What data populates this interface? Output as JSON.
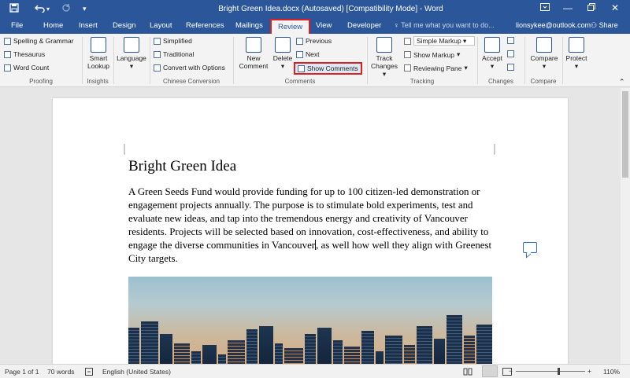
{
  "titlebar": {
    "title": "Bright Green Idea.docx (Autosaved) [Compatibility Mode] - Word",
    "save_icon": "save-icon",
    "undo_icon": "undo-icon",
    "redo_icon": "redo-icon"
  },
  "tabs": [
    "File",
    "Home",
    "Insert",
    "Design",
    "Layout",
    "References",
    "Mailings",
    "Review",
    "View",
    "Developer"
  ],
  "active_tab": "Review",
  "tell_me": "Tell me what you want to do...",
  "account": {
    "user": "lionsykee@outlook.com",
    "share": "Share"
  },
  "ribbon": {
    "proofing": {
      "spelling": "Spelling & Grammar",
      "thesaurus": "Thesaurus",
      "word_count": "Word Count",
      "label": "Proofing"
    },
    "insights": {
      "smart_lookup": "Smart Lookup",
      "label": "Insights"
    },
    "language": {
      "language": "Language"
    },
    "chinese": {
      "simplified": "Simplified",
      "traditional": "Traditional",
      "convert": "Convert with Options",
      "label": "Chinese Conversion"
    },
    "comments": {
      "new_comment": "New Comment",
      "delete": "Delete",
      "previous": "Previous",
      "next": "Next",
      "show_comments": "Show Comments",
      "label": "Comments"
    },
    "tracking": {
      "track_changes": "Track Changes",
      "simple_markup": "Simple Markup",
      "show_markup": "Show Markup",
      "reviewing_pane": "Reviewing Pane",
      "label": "Tracking"
    },
    "changes": {
      "accept": "Accept",
      "label": "Changes"
    },
    "compare": {
      "compare": "Compare",
      "label": "Compare"
    },
    "protect": {
      "protect": "Protect"
    }
  },
  "document": {
    "title": "Bright Green Idea",
    "body_before_cursor": " A Green Seeds Fund would provide funding for up to 100 citizen-led demonstration or engagement projects annually. The purpose is to stimulate bold experiments, test and evaluate new ideas, and tap into the tremendous energy and creativity of Vancouver residents. Projects will be selected based on innovation, cost-effectiveness, and ability to engage the diverse communities in Vancouver",
    "body_after_cursor": ", as well how well they align with Greenest City targets."
  },
  "status": {
    "page": "Page 1 of 1",
    "words": "70 words",
    "language": "English (United States)",
    "zoom": "110%"
  }
}
